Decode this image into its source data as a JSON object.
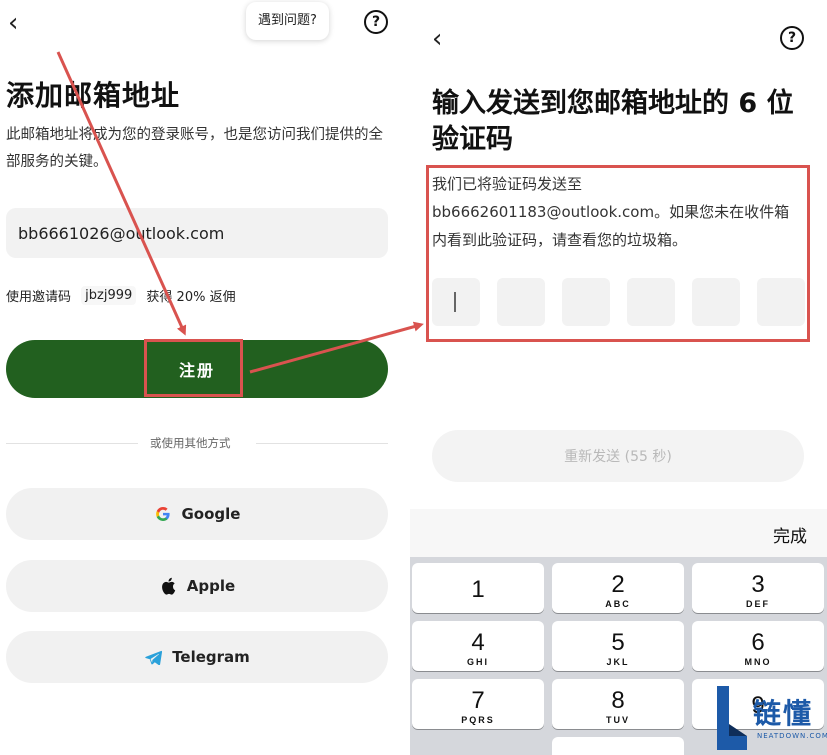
{
  "left": {
    "back_icon": "chevron-left-icon",
    "help_bubble": "遇到问题?",
    "help_icon": "?",
    "title": "添加邮箱地址",
    "description": "此邮箱地址将成为您的登录账号，也是您访问我们提供的全部服务的关键。",
    "email_value": "bb6661026@outlook.com",
    "invite": {
      "prefix": "使用邀请码",
      "code": "jbzj999",
      "suffix": "获得 20% 返佣"
    },
    "register_button": "注册",
    "divider_text": "或使用其他方式",
    "social": [
      {
        "label": "Google",
        "icon": "google-icon"
      },
      {
        "label": "Apple",
        "icon": "apple-icon"
      },
      {
        "label": "Telegram",
        "icon": "telegram-icon"
      }
    ]
  },
  "right": {
    "back_icon": "chevron-left-icon",
    "help_icon": "?",
    "title": "输入发送到您邮箱地址的 6 位验证码",
    "description_line1": "我们已将验证码发送至",
    "email": "bb6662601183@outlook.com",
    "description_rest": "。如果您未在收件箱内看到此验证码，请查看您的垃圾箱。",
    "code_boxes": [
      "",
      "",
      "",
      "",
      "",
      ""
    ],
    "resend_button": "重新发送 (55 秒)",
    "keyboard": {
      "done": "完成",
      "keys": [
        {
          "num": "1",
          "letters": ""
        },
        {
          "num": "2",
          "letters": "ABC"
        },
        {
          "num": "3",
          "letters": "DEF"
        },
        {
          "num": "4",
          "letters": "GHI"
        },
        {
          "num": "5",
          "letters": "JKL"
        },
        {
          "num": "6",
          "letters": "MNO"
        },
        {
          "num": "7",
          "letters": "PQRS"
        },
        {
          "num": "8",
          "letters": "TUV"
        },
        {
          "num": "9",
          "letters": ""
        }
      ]
    }
  },
  "annotation_color": "#d9534f",
  "brand_color": "#22601f",
  "watermark": {
    "text": "链懂",
    "sub": "NEATDOWN.COM",
    "logo": "L"
  }
}
